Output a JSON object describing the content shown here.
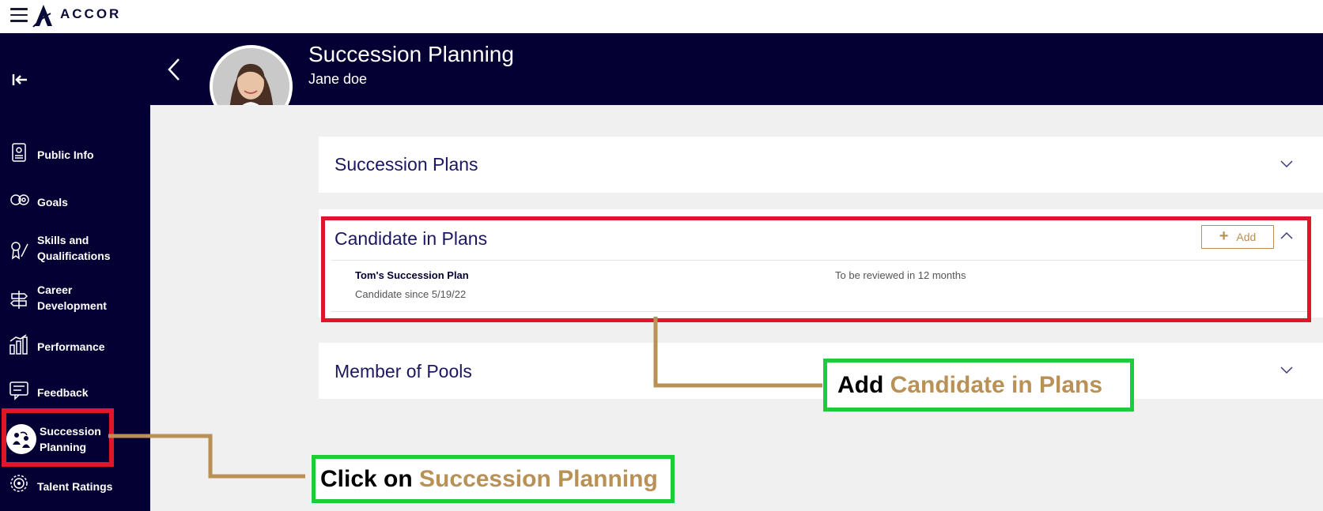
{
  "brand": {
    "name": "ACCOR"
  },
  "header": {
    "title": "Succession Planning",
    "subtitle": "Jane doe"
  },
  "sidebar": {
    "items": [
      {
        "label": "Public Info"
      },
      {
        "label": "Goals"
      },
      {
        "label_line1": "Skills and",
        "label_line2": "Qualifications"
      },
      {
        "label_line1": "Career",
        "label_line2": "Development"
      },
      {
        "label": "Performance"
      },
      {
        "label": "Feedback"
      },
      {
        "label_line1": "Succession",
        "label_line2": "Planning",
        "active": true
      },
      {
        "label": "Talent Ratings"
      }
    ]
  },
  "panels": {
    "succession_plans": {
      "title": "Succession Plans"
    },
    "candidate_in_plans": {
      "title": "Candidate in Plans",
      "add_label": "Add",
      "rows": [
        {
          "name": "Tom's Succession Plan",
          "since": "Candidate since 5/19/22",
          "review": "To be reviewed in 12 months"
        }
      ]
    },
    "member_of_pools": {
      "title": "Member of Pools"
    }
  },
  "callouts": {
    "add": {
      "plain": "Add",
      "accent": "Candidate in Plans"
    },
    "click": {
      "plain": "Click on",
      "accent": "Succession Planning"
    }
  },
  "colors": {
    "navy": "#050033",
    "gold": "#b99056",
    "highlight_red": "#e0142a",
    "highlight_green": "#1ccc3c"
  }
}
